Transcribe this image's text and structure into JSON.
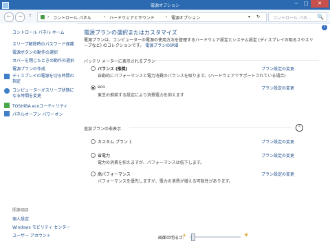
{
  "window": {
    "title": "電源オプション"
  },
  "titlebar": {
    "min": "─",
    "max": "□",
    "close": "✕"
  },
  "nav": {
    "back": "←",
    "forward": "→",
    "up": "↑"
  },
  "address": {
    "crumbs": [
      "コントロール パネル",
      "ハードウェアとサウンド",
      "電源オプション"
    ],
    "separator": "›",
    "dropdown": "▾",
    "refresh": "↻"
  },
  "search": {
    "placeholder": "コントロール パネ...",
    "icon": "🔍"
  },
  "help": {
    "label": "?"
  },
  "sidebar": {
    "home": "コントロール パネル ホーム",
    "items": [
      "スリープ解除時のパスワード保護",
      "電源ボタンの動作の選択",
      "カバーを閉じたときの動作の選択",
      "電源プランの作成",
      "ディスプレイの電源を切る時間の指定",
      "コンピューターがスリープ状態になる時間を変更",
      "TOSHIBA ecoユーティリティ",
      "パネルオープン パワーオン"
    ],
    "related_label": "関連項目",
    "related": [
      "個人設定",
      "Windows モビリティ センター",
      "ユーザー アカウント"
    ]
  },
  "main": {
    "heading": "電源プランの選択またはカスタマイズ",
    "description": "電源プランは、コンピューターの電源の使用方法を管理するハードウェア設定とシステム設定 (ディスプレイの明るさやスリープなど) のコレクションです。",
    "description_link": "電源プランの詳細",
    "battery_group_label": "バッテリ メーターに表示されるプラン",
    "hidden_group_label": "追加プランの非表示",
    "collapse": "⌃",
    "change_link": "プラン設定の変更",
    "plans_shown": [
      {
        "name": "バランス (推奨)",
        "desc": "自動的にパフォーマンスと電力消費のバランスを取ります。(ハードウェアでサポートされている場合)",
        "selected": false
      },
      {
        "name": "eco",
        "desc": "東芝の推奨する設定により消費電力を抑えます",
        "selected": true
      }
    ],
    "plans_hidden": [
      {
        "name": "カスタム プラン 1",
        "desc": "",
        "selected": false
      },
      {
        "name": "省電力",
        "desc": "電力の消費を抑えますが、パフォーマンスは低下します。",
        "selected": false
      },
      {
        "name": "高パフォーマンス",
        "desc": "パフォーマンスを優先しますが、電力の消費が増える可能性があります。",
        "selected": false
      }
    ]
  },
  "bottom": {
    "brightness_label": "画面の明るさ:",
    "brightness_level": 0.03
  }
}
